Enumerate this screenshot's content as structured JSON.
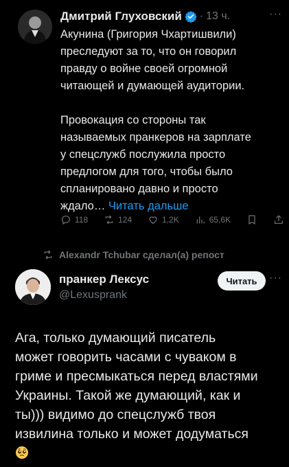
{
  "tweet": {
    "author_name": "Дмитрий Глуховский",
    "separator": "·",
    "time": "13 ч.",
    "more": "···",
    "lines": [
      "Акунина (Григория Чхартишвили)",
      "преследуют за то, что он говорил",
      "правду о войне своей огромной",
      "читающей и думающей аудитории."
    ],
    "lines2": [
      "Провокация со стороны так",
      "называемых пранкеров на зарплате",
      "у спецслужб послужила просто",
      "предлогом для того, чтобы было",
      "спланировано давно и просто"
    ],
    "last_line_start": "ждало…",
    "read_more": "Читать дальше",
    "stats": {
      "replies": "118",
      "reposts": "124",
      "likes": "1,2K",
      "views": "65,6K"
    }
  },
  "repost": {
    "text": "Alexandr Tchubar сделал(а) репост"
  },
  "quote": {
    "author_name": "пранкер Лексус",
    "handle": "@Lexusprank",
    "follow_label": "Читать",
    "more": "···",
    "lines": [
      "Ага, только думающий писатель",
      "может говорить часами с чуваком  в",
      "гриме и пресмыкаться перед властями",
      "Украины. Такой же думающий, как и",
      "ты))) видимо до спецслужб твоя",
      "извилина только и может додуматься"
    ],
    "emoji": "pleading-face"
  },
  "colors": {
    "background": "#000000",
    "text": "#e7e9ea",
    "muted": "#71767b",
    "accent": "#1d9bf0"
  }
}
